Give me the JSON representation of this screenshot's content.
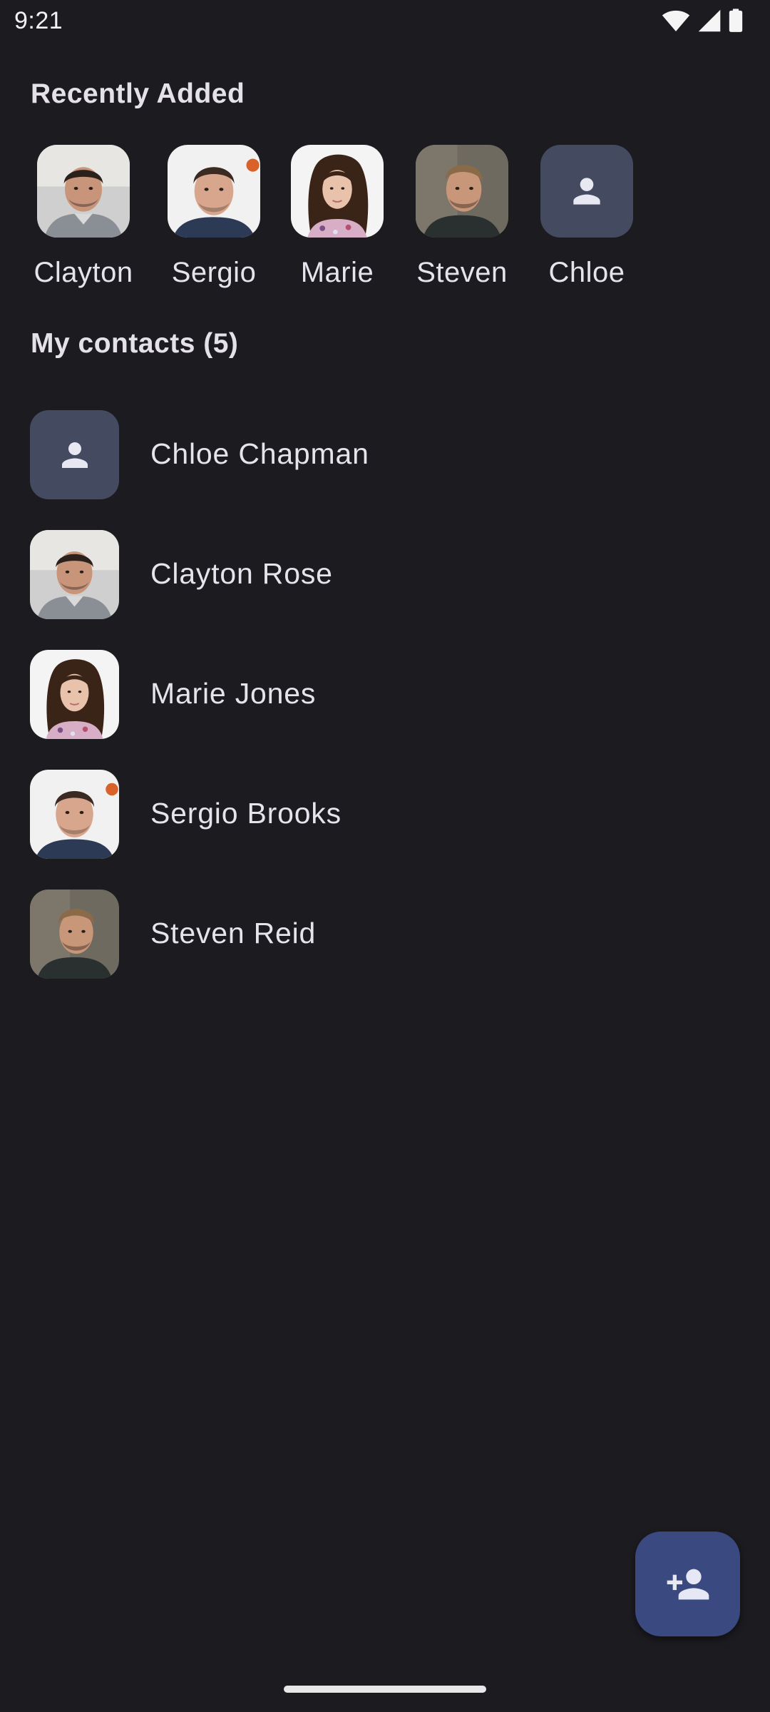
{
  "status_bar": {
    "time": "9:21",
    "icons": [
      "wifi-icon",
      "cell-signal-icon",
      "battery-icon"
    ]
  },
  "recent": {
    "heading": "Recently Added",
    "items": [
      {
        "name": "Clayton",
        "avatar": "photo"
      },
      {
        "name": "Sergio",
        "avatar": "photo"
      },
      {
        "name": "Marie",
        "avatar": "photo"
      },
      {
        "name": "Steven",
        "avatar": "photo"
      },
      {
        "name": "Chloe",
        "avatar": "person-placeholder-icon"
      }
    ]
  },
  "contacts": {
    "heading": "My contacts (5)",
    "items": [
      {
        "name": "Chloe Chapman",
        "avatar": "person-placeholder-icon"
      },
      {
        "name": "Clayton Rose",
        "avatar": "photo"
      },
      {
        "name": "Marie Jones",
        "avatar": "photo"
      },
      {
        "name": "Sergio Brooks",
        "avatar": "photo"
      },
      {
        "name": "Steven Reid",
        "avatar": "photo"
      }
    ]
  },
  "fab": {
    "icon": "add-person-icon"
  },
  "colors": {
    "background": "#1b1b20",
    "placeholder_avatar": "#444a5f",
    "fab": "#3a4a80",
    "text": "#e6e3ec"
  }
}
